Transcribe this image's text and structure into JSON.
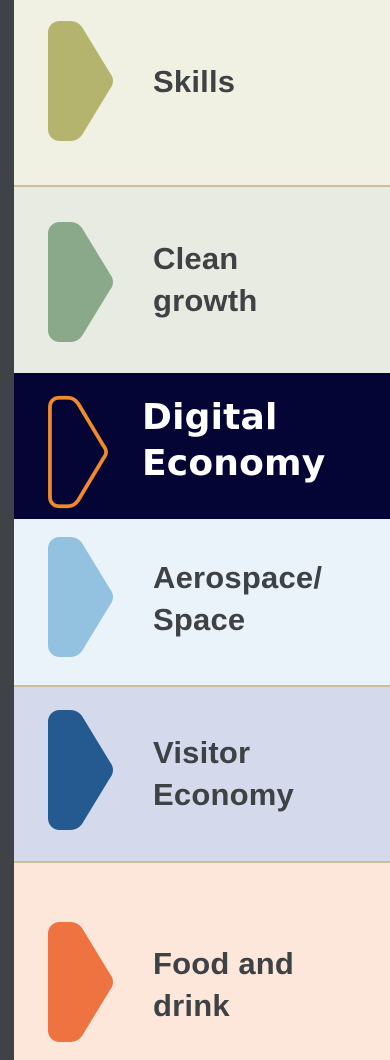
{
  "nav": {
    "items": [
      {
        "label_line1": "Skills",
        "label_line2": "",
        "bg": "#f1f1e3",
        "chevron": "#b5b46f",
        "active": false,
        "icon": "chevron-right-icon"
      },
      {
        "label_line1": "Clean",
        "label_line2": "growth",
        "bg": "#e8ebe2",
        "chevron": "#8aa88a",
        "active": false,
        "icon": "chevron-right-icon"
      },
      {
        "label_line1": "Digital",
        "label_line2": "Economy",
        "bg": "#050535",
        "chevron": "#f08a2c",
        "active": true,
        "icon": "chevron-right-outline-icon"
      },
      {
        "label_line1": "Aerospace/",
        "label_line2": "Space",
        "bg": "#eaf2fa",
        "chevron": "#93c1e0",
        "active": false,
        "icon": "chevron-right-icon"
      },
      {
        "label_line1": "Visitor",
        "label_line2": "Economy",
        "bg": "#d5d9ec",
        "chevron": "#245a8f",
        "active": false,
        "icon": "chevron-right-icon"
      },
      {
        "label_line1": "Food and",
        "label_line2": "drink",
        "bg": "#fde6da",
        "chevron": "#ef7340",
        "active": false,
        "icon": "chevron-right-icon"
      }
    ]
  },
  "colors": {
    "frame": "#3f4348",
    "divider": "#cbbf9b",
    "label_text": "#3f4245",
    "active_text": "#ffffff"
  }
}
